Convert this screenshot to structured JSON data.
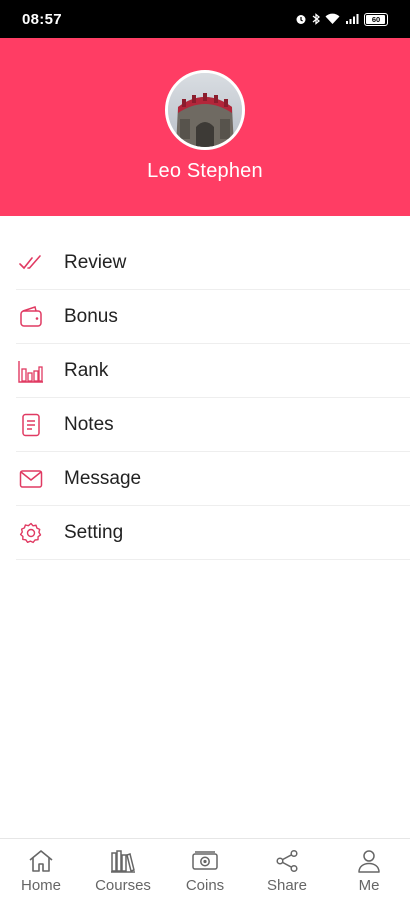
{
  "status_bar": {
    "time": "08:57",
    "icons": [
      "alarm-icon",
      "bluetooth-icon",
      "wifi-icon",
      "signal-icon",
      "battery-icon"
    ],
    "battery": "60"
  },
  "profile": {
    "name": "Leo Stephen",
    "avatar": "castle-tower-photo"
  },
  "menu": {
    "items": [
      {
        "label": "Review",
        "icon": "double-check-icon"
      },
      {
        "label": "Bonus",
        "icon": "wallet-icon"
      },
      {
        "label": "Rank",
        "icon": "bar-chart-icon"
      },
      {
        "label": "Notes",
        "icon": "notes-icon"
      },
      {
        "label": "Message",
        "icon": "envelope-icon"
      },
      {
        "label": "Setting",
        "icon": "gear-icon"
      }
    ]
  },
  "bottom_nav": {
    "items": [
      {
        "label": "Home",
        "icon": "home-icon"
      },
      {
        "label": "Courses",
        "icon": "books-icon"
      },
      {
        "label": "Coins",
        "icon": "banknote-icon"
      },
      {
        "label": "Share",
        "icon": "share-icon"
      },
      {
        "label": "Me",
        "icon": "person-icon"
      }
    ]
  },
  "colors": {
    "accent": "#ff3d64",
    "icon": "#e03a62",
    "nav_icon": "#666666"
  }
}
